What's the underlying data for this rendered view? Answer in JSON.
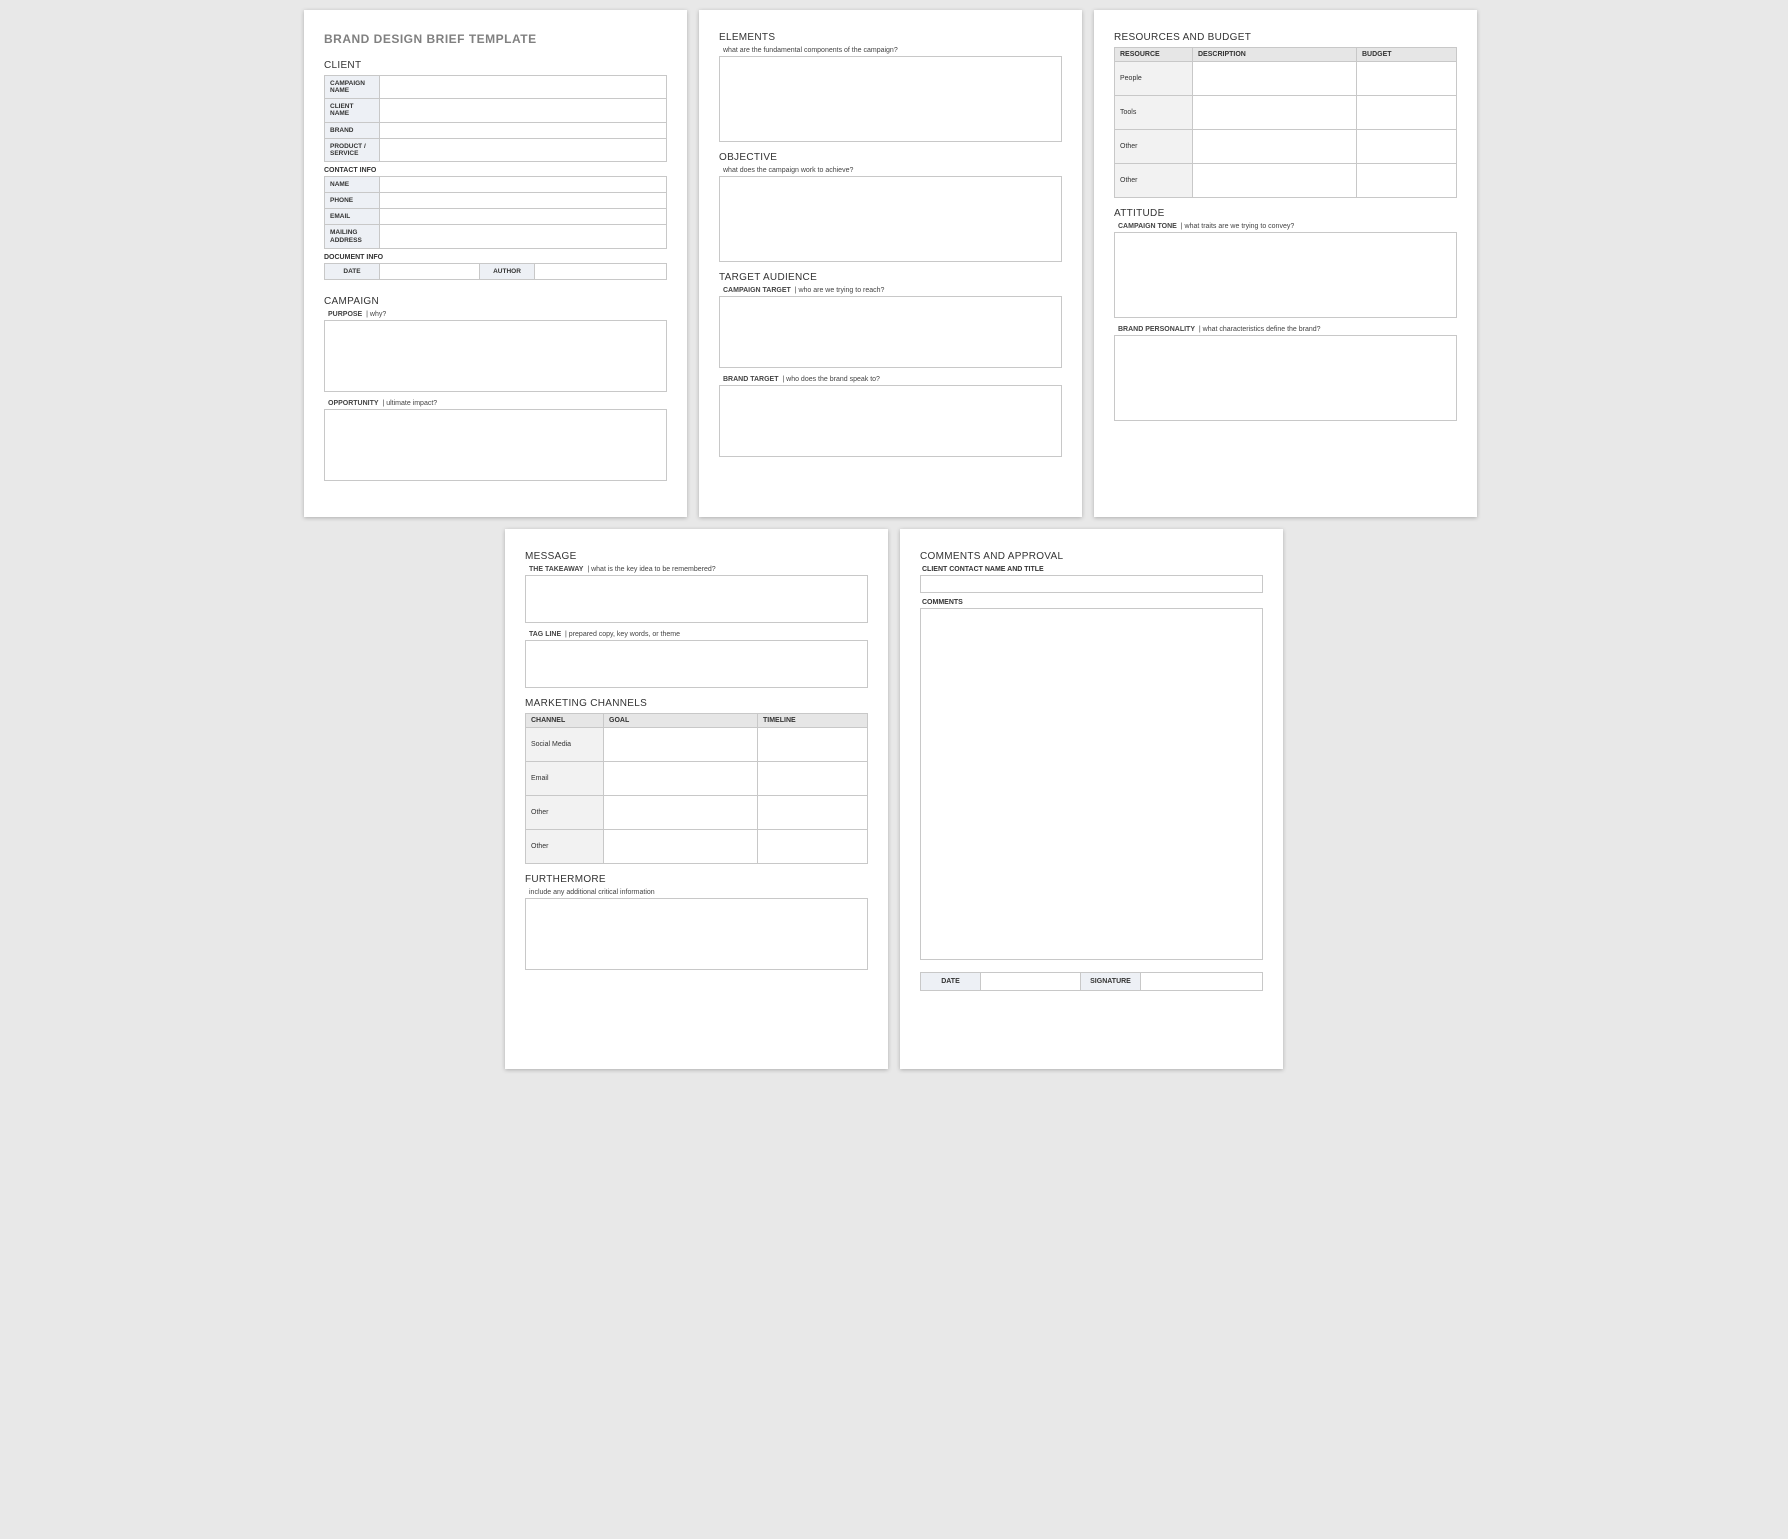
{
  "doc_title": "BRAND DESIGN BRIEF TEMPLATE",
  "p1": {
    "client_head": "CLIENT",
    "rows": {
      "campaign_name": "CAMPAIGN NAME",
      "client_name": "CLIENT NAME",
      "brand": "BRAND",
      "product_service": "PRODUCT / SERVICE"
    },
    "contact_head": "CONTACT INFO",
    "contact": {
      "name": "NAME",
      "phone": "PHONE",
      "email": "EMAIL",
      "mailing": "MAILING ADDRESS"
    },
    "docinfo_head": "DOCUMENT INFO",
    "docinfo": {
      "date": "DATE",
      "author": "AUTHOR"
    },
    "campaign_head": "CAMPAIGN",
    "purpose_label": "PURPOSE",
    "purpose_hint": "|   why?",
    "opportunity_label": "OPPORTUNITY",
    "opportunity_hint": "|   ultimate impact?"
  },
  "p2": {
    "elements_head": "ELEMENTS",
    "elements_hint": "what are the fundamental components of the campaign?",
    "objective_head": "OBJECTIVE",
    "objective_hint": "what does the campaign work to achieve?",
    "target_head": "TARGET AUDIENCE",
    "ct_label": "CAMPAIGN TARGET",
    "ct_hint": "|   who are we trying to reach?",
    "bt_label": "BRAND TARGET",
    "bt_hint": "|   who does the brand speak to?"
  },
  "p3": {
    "rb_head": "RESOURCES AND BUDGET",
    "cols": {
      "resource": "RESOURCE",
      "description": "DESCRIPTION",
      "budget": "BUDGET"
    },
    "rows": [
      "People",
      "Tools",
      "Other",
      "Other"
    ],
    "att_head": "ATTITUDE",
    "tone_label": "CAMPAIGN TONE",
    "tone_hint": "|   what traits are we trying to convey?",
    "bp_label": "BRAND PERSONALITY",
    "bp_hint": "|   what characteristics define the brand?"
  },
  "p4": {
    "msg_head": "MESSAGE",
    "take_label": "THE TAKEAWAY",
    "take_hint": "|   what is the key idea to be remembered?",
    "tag_label": "TAG LINE",
    "tag_hint": "|   prepared copy, key words, or theme",
    "mc_head": "MARKETING CHANNELS",
    "cols": {
      "channel": "CHANNEL",
      "goal": "GOAL",
      "timeline": "TIMELINE"
    },
    "rows": [
      "Social Media",
      "Email",
      "Other",
      "Other"
    ],
    "further_head": "FURTHERMORE",
    "further_hint": "include any additional critical information"
  },
  "p5": {
    "ca_head": "COMMENTS AND APPROVAL",
    "contact_label": "CLIENT CONTACT NAME AND TITLE",
    "comments_label": "COMMENTS",
    "sig": {
      "date": "DATE",
      "signature": "SIGNATURE"
    }
  }
}
